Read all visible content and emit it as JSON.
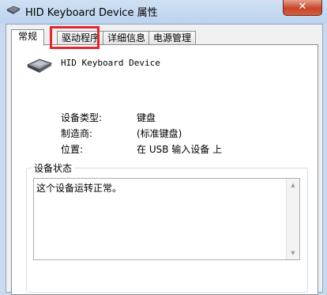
{
  "window": {
    "title": "HID Keyboard Device 属性",
    "close_glyph": "✕"
  },
  "tabs": [
    {
      "label": "常规",
      "active": true
    },
    {
      "label": "驱动程序",
      "active": false
    },
    {
      "label": "详细信息",
      "active": false
    },
    {
      "label": "电源管理",
      "active": false
    }
  ],
  "device": {
    "name": "HID Keyboard Device",
    "icon": "keyboard-icon"
  },
  "properties": [
    {
      "label": "设备类型:",
      "value": "键盘"
    },
    {
      "label": "制造商:",
      "value": "(标准键盘)"
    },
    {
      "label": "位置:",
      "value": "在 USB 输入设备 上"
    }
  ],
  "device_status": {
    "title": "设备状态",
    "text": "这个设备运转正常。"
  },
  "colors": {
    "highlight": "#e3262b",
    "close_button": "#c8452b"
  }
}
